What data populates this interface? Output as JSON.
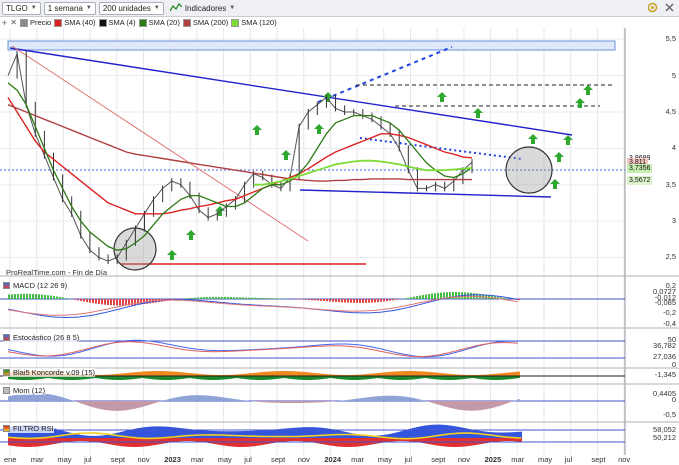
{
  "toolbar": {
    "ticker": "TLGO",
    "period": "1 semana",
    "units": "200 unidades",
    "indicators": "Indicadores"
  },
  "legend": [
    {
      "label": "Precio",
      "color": "#8a8a8a",
      "icon": "price-icon"
    },
    {
      "label": "SMA (40)",
      "color": "#dd2222",
      "icon": "sma-icon"
    },
    {
      "label": "SMA (4)",
      "color": "#111111",
      "icon": "sma-icon"
    },
    {
      "label": "SMA (20)",
      "color": "#2c7a14",
      "icon": "sma-icon"
    },
    {
      "label": "SMA (200)",
      "color": "#b04040",
      "icon": "sma-icon"
    },
    {
      "label": "SMA (120)",
      "color": "#7cdc35",
      "icon": "sma-icon"
    }
  ],
  "price_axis": {
    "ticks": [
      "5,5",
      "5",
      "4,5",
      "4",
      "3,5",
      "3",
      "2,5"
    ],
    "tags": [
      {
        "label": "3,8688",
        "color": "#ffffff"
      },
      {
        "label": "3,811",
        "color": "#f4c7c3"
      },
      {
        "label": "3,7356",
        "color": "#c6efb0"
      },
      {
        "label": "3,5672",
        "color": "#ddf3cc"
      }
    ]
  },
  "source": "ProRealTime.com - Fin de Día",
  "panels": {
    "macd": {
      "label": "MACD (12 26 9)",
      "ticks": [
        "0,2",
        "0,0727",
        "-0,012",
        "-0,085",
        "-0,2",
        "-0,4"
      ]
    },
    "stoch": {
      "label": "Estocástico (26 8 5)",
      "ticks": [
        "50",
        "36,782",
        "27,036",
        "0"
      ]
    },
    "koncorde": {
      "label": "Blai5 Koncorde v.09 (15)",
      "ticks": [
        "-1,345"
      ]
    },
    "mom": {
      "label": "Mom (12)",
      "ticks": [
        "0,4405",
        "0",
        "-0,5"
      ]
    },
    "rsi": {
      "label": "FILTRO RSI",
      "ticks": [
        "58,052",
        "50,212"
      ]
    }
  },
  "months": [
    "ene",
    "mar",
    "may",
    "jul",
    "sept",
    "nov",
    "2023",
    "mar",
    "may",
    "jul",
    "sept",
    "nov",
    "2024",
    "mar",
    "may",
    "jul",
    "sept",
    "nov",
    "2025",
    "mar",
    "may",
    "jul",
    "sept",
    "nov"
  ],
  "chart_data": {
    "type": "line",
    "title": "TLGO",
    "y_range": [
      2.3,
      5.6
    ],
    "series": [
      {
        "name": "Precio",
        "values": [
          5.0,
          5.3,
          4.6,
          4.2,
          3.9,
          3.6,
          3.3,
          3.1,
          2.8,
          2.6,
          2.5,
          2.45,
          2.5,
          2.7,
          2.9,
          3.1,
          3.3,
          3.45,
          3.55,
          3.5,
          3.35,
          3.15,
          3.05,
          3.1,
          3.2,
          3.3,
          3.5,
          3.65,
          3.6,
          3.5,
          3.45,
          3.6,
          4.3,
          4.5,
          4.6,
          4.7,
          4.55,
          4.5,
          4.5,
          4.45,
          4.4,
          4.3,
          4.2,
          4.0,
          3.7,
          3.45,
          3.45,
          3.5,
          3.45,
          3.55,
          3.7,
          3.81
        ]
      },
      {
        "name": "SMA (40)",
        "values": [
          4.7,
          4.5,
          4.3,
          4.1,
          3.95,
          3.85,
          3.75,
          3.65,
          3.55,
          3.45,
          3.35,
          3.25,
          3.2,
          3.15,
          3.1,
          3.1,
          3.1,
          3.1,
          3.12,
          3.15,
          3.17,
          3.2,
          3.22,
          3.25,
          3.28,
          3.3,
          3.35,
          3.4,
          3.45,
          3.5,
          3.55,
          3.6,
          3.65,
          3.72,
          3.8,
          3.88,
          3.95,
          4.0,
          4.05,
          4.1,
          4.15,
          4.2,
          4.2,
          4.18,
          4.15,
          4.1,
          4.05,
          4.0,
          3.95,
          3.92,
          3.88,
          3.87
        ]
      },
      {
        "name": "SMA (200)",
        "values": [
          4.6,
          4.55,
          4.5,
          4.45,
          4.4,
          4.35,
          4.3,
          4.25,
          4.2,
          4.15,
          4.1,
          4.05,
          4.0,
          3.95,
          3.92,
          3.9,
          3.88,
          3.86,
          3.84,
          3.82,
          3.8,
          3.78,
          3.76,
          3.74,
          3.72,
          3.7,
          3.68,
          3.66,
          3.64,
          3.62,
          3.6,
          3.58,
          3.57,
          3.56,
          3.55,
          3.55,
          3.56,
          3.56,
          3.57,
          3.57,
          3.58,
          3.58,
          3.58,
          3.58,
          3.57,
          3.57,
          3.57,
          3.57,
          3.57,
          3.57,
          3.57,
          3.57
        ]
      },
      {
        "name": "SMA (20)",
        "values": [
          4.9,
          4.8,
          4.6,
          4.3,
          4.0,
          3.7,
          3.45,
          3.2,
          3.0,
          2.85,
          2.75,
          2.65,
          2.6,
          2.62,
          2.7,
          2.8,
          2.95,
          3.1,
          3.2,
          3.3,
          3.35,
          3.35,
          3.3,
          3.25,
          3.2,
          3.2,
          3.25,
          3.35,
          3.45,
          3.5,
          3.5,
          3.55,
          3.65,
          3.8,
          4.0,
          4.2,
          4.35,
          4.4,
          4.45,
          4.45,
          4.45,
          4.4,
          4.35,
          4.25,
          4.1,
          3.95,
          3.8,
          3.7,
          3.62,
          3.6,
          3.65,
          3.74
        ]
      },
      {
        "name": "SMA (120)",
        "values": [
          null,
          null,
          null,
          null,
          null,
          null,
          null,
          null,
          null,
          null,
          null,
          null,
          null,
          null,
          null,
          null,
          null,
          null,
          null,
          null,
          null,
          null,
          null,
          null,
          null,
          null,
          null,
          3.5,
          3.5,
          3.52,
          3.55,
          3.58,
          3.62,
          3.66,
          3.7,
          3.74,
          3.78,
          3.8,
          3.82,
          3.83,
          3.83,
          3.82,
          3.8,
          3.78,
          3.75,
          3.72,
          3.7,
          3.7,
          3.7,
          3.71,
          3.72,
          3.73
        ]
      }
    ]
  }
}
